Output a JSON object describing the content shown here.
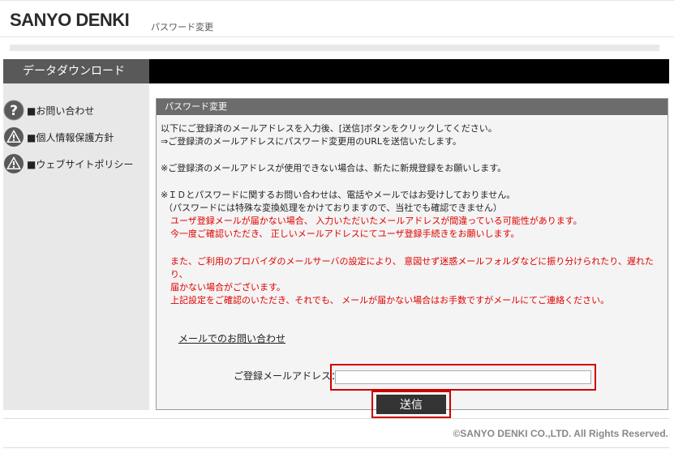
{
  "header": {
    "logo": "SANYO DENKI",
    "subtitle": "パスワード変更"
  },
  "sidebar": {
    "title": "データダウンロード",
    "links": [
      {
        "label": "■お問い合わせ",
        "icon": "question-icon"
      },
      {
        "label": "■個人情報保護方針",
        "icon": "warning-icon"
      },
      {
        "label": "■ウェブサイトポリシー",
        "icon": "warning-icon"
      }
    ]
  },
  "panel": {
    "title": "パスワード変更",
    "lines": [
      "以下にご登録済のメールアドレスを入力後、[送信]ボタンをクリックしてください。",
      "⇒ご登録済のメールアドレスにパスワード変更用のURLを送信いたします。",
      "※ご登録済のメールアドレスが使用できない場合は、新たに新規登録をお願いします。",
      "※ＩＤとパスワードに関するお問い合わせは、電話やメールではお受けしておりません。",
      "（パスワードには特殊な変換処理をかけておりますので、当社でも確認できません）"
    ],
    "red_lines": [
      "ユーザ登録メールが届かない場合、 入力いただいたメールアドレスが間違っている可能性があります。",
      "今一度ご確認いただき、 正しいメールアドレスにてユーザ登録手続きをお願いします。",
      "また、ご利用のプロバイダのメールサーバの設定により、 意図せず迷惑メールフォルダなどに振り分けられたり、遅れた",
      "り、",
      "届かない場合がございます。",
      "上記設定をご確認のいただき、それでも、 メールが届かない場合はお手数ですがメールにてご連絡ください。"
    ],
    "mail_link": "メールでのお問い合わせ",
    "email_label": "ご登録メールアドレス：",
    "email_value": "",
    "email_placeholder": "",
    "send_label": "送信"
  },
  "footer": {
    "copyright": "©SANYO DENKI CO.,LTD. All Rights Reserved."
  },
  "colors": {
    "accent_red": "#cc0000",
    "text_red": "#e00000",
    "sidebar_bg": "#e8e8e8",
    "panel_title_bg": "#6c6c6c"
  }
}
